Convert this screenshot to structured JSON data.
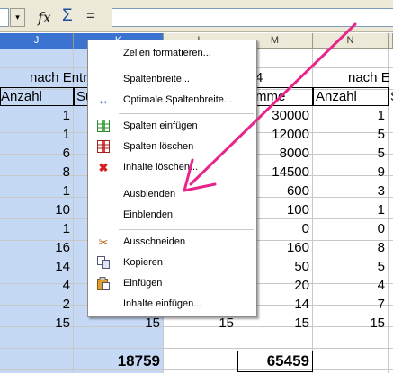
{
  "toolbar": {
    "namebox_value": "",
    "dropdown_icon": "▾",
    "function_wizard_icon": "fx",
    "sum_icon": "Σ",
    "formula_icon": "=",
    "formula_value": ""
  },
  "columns": [
    "J",
    "K",
    "L",
    "M",
    "N"
  ],
  "sheet": {
    "header_row_left": "nach Entr",
    "header_row_right": "nach E",
    "header_m_fragment": "4",
    "col_j_header": "Anzahl",
    "col_k_header": "Su",
    "col_m_header": "mme",
    "col_n_header": "Anzahl",
    "col_o_header": "S",
    "rows": [
      {
        "j": "1",
        "m": "30000",
        "n": "1"
      },
      {
        "j": "1",
        "m": "12000",
        "n": "5"
      },
      {
        "j": "6",
        "m": "8000",
        "n": "5"
      },
      {
        "j": "8",
        "m": "14500",
        "n": "9"
      },
      {
        "j": "1",
        "m": "600",
        "n": "3"
      },
      {
        "j": "10",
        "m": "100",
        "n": "1"
      },
      {
        "j": "1",
        "m": "0",
        "n": "0"
      },
      {
        "j": "16",
        "m": "160",
        "n": "8"
      },
      {
        "j": "14",
        "m": "50",
        "n": "5"
      },
      {
        "j": "4",
        "m": "20",
        "n": "4"
      },
      {
        "j": "2",
        "m": "14",
        "n": "7"
      },
      {
        "j": "15",
        "k": "15",
        "l": "15",
        "m": "15",
        "n": "15"
      }
    ],
    "total_k": "18759",
    "total_m": "65459"
  },
  "context_menu": {
    "items": [
      {
        "label": "Zellen formatieren...",
        "icon": ""
      },
      {
        "label": "Spaltenbreite...",
        "icon": ""
      },
      {
        "label": "Optimale Spaltenbreite...",
        "icon": "optimal-width-icon"
      },
      {
        "label": "Spalten einfügen",
        "icon": "insert-columns-icon"
      },
      {
        "label": "Spalten löschen",
        "icon": "delete-columns-icon"
      },
      {
        "label": "Inhalte löschen...",
        "icon": "delete-contents-icon"
      },
      {
        "label": "Ausblenden",
        "icon": ""
      },
      {
        "label": "Einblenden",
        "icon": ""
      },
      {
        "label": "Ausschneiden",
        "icon": "cut-icon"
      },
      {
        "label": "Kopieren",
        "icon": "copy-icon"
      },
      {
        "label": "Einfügen",
        "icon": "paste-icon"
      },
      {
        "label": "Inhalte einfügen...",
        "icon": ""
      }
    ]
  },
  "colors": {
    "selection_header": "#3b73d1",
    "selection_fill": "#c6d9f4",
    "annotation_arrow": "#e8258c"
  }
}
